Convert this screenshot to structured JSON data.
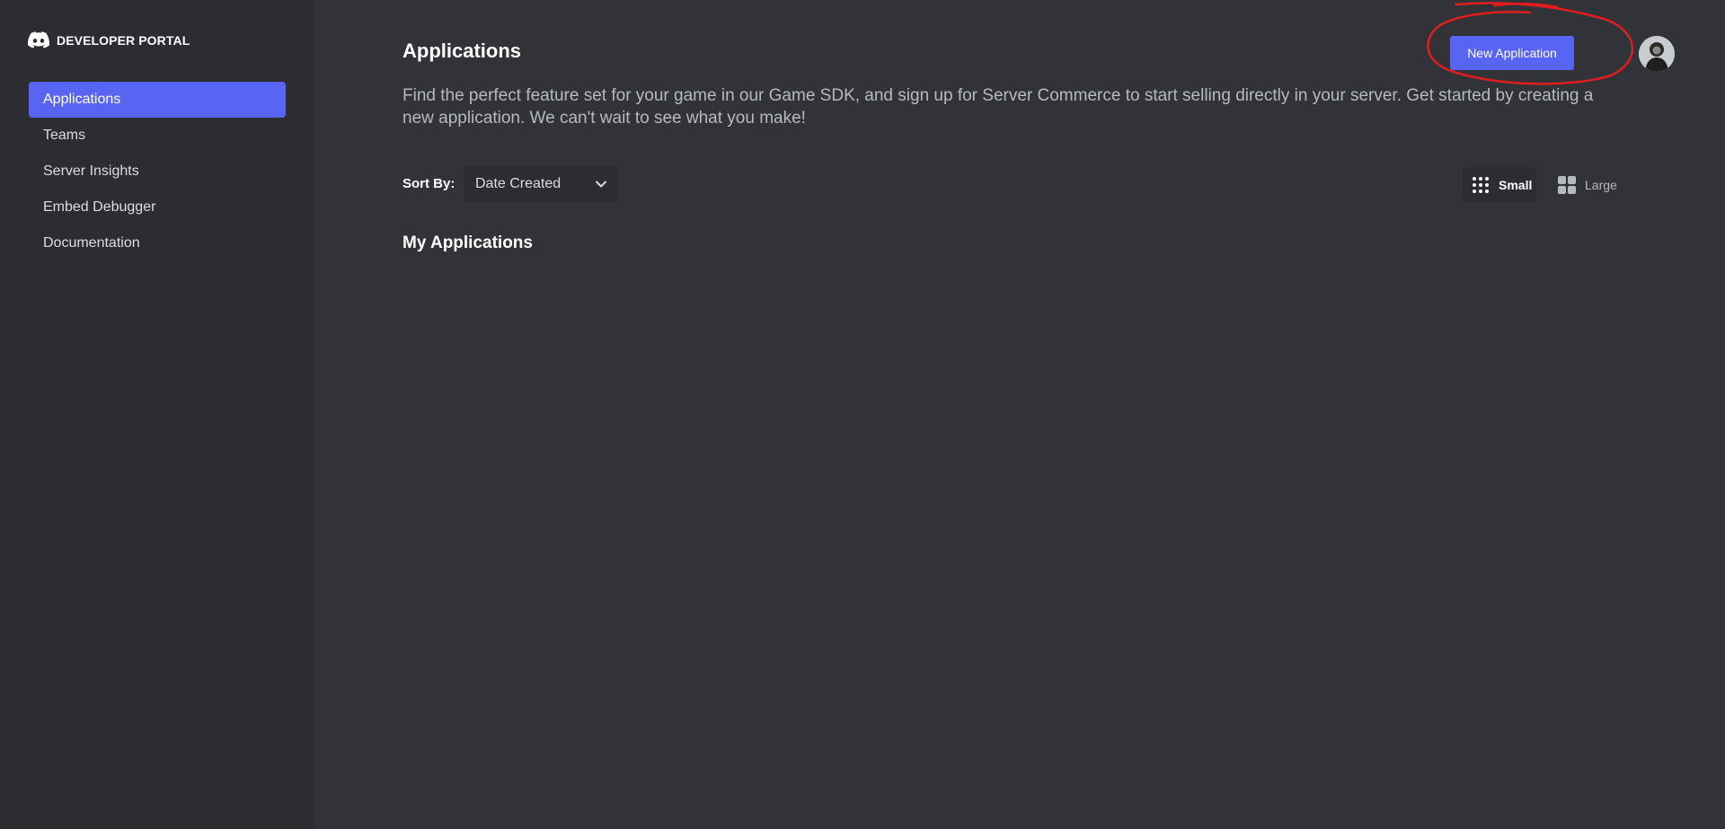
{
  "brand": {
    "name": "DEVELOPER PORTAL",
    "logo_icon": "discord-logo-icon"
  },
  "sidebar": {
    "items": [
      {
        "label": "Applications",
        "active": true
      },
      {
        "label": "Teams",
        "active": false
      },
      {
        "label": "Server Insights",
        "active": false
      },
      {
        "label": "Embed Debugger",
        "active": false
      },
      {
        "label": "Documentation",
        "active": false
      }
    ]
  },
  "header": {
    "title": "Applications",
    "new_button_label": "New Application",
    "avatar_icon": "user-avatar"
  },
  "description": "Find the perfect feature set for your game in our Game SDK, and sign up for Server Commerce to start selling directly in your server. Get started by creating a new application. We can't wait to see what you make!",
  "sort": {
    "label": "Sort By:",
    "value": "Date Created"
  },
  "view_toggle": {
    "small_label": "Small",
    "large_label": "Large",
    "selected": "Small"
  },
  "my_apps": {
    "title": "My Applications",
    "items": []
  },
  "colors": {
    "accent": "#5865f2",
    "background": "#313338",
    "sidebar": "#2b2d31",
    "annotation": "#e11d1d"
  }
}
